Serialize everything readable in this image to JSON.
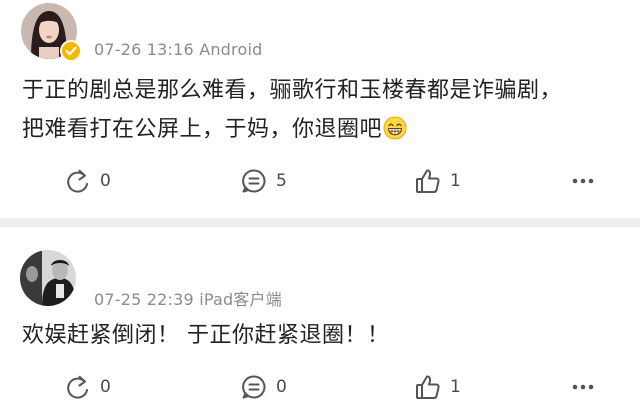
{
  "posts": [
    {
      "timestamp": "07-26 13:16",
      "source": "Android",
      "line1": "于正的剧总是那么难看，骊歌行和玉楼春都是诈骗剧，",
      "line2": "把难看打在公屏上，于妈，你退圈吧",
      "emoji": "grinning-face-icon",
      "reposts": "0",
      "comments": "5",
      "likes": "1",
      "verified": true,
      "badge_color": "#f5b800"
    },
    {
      "timestamp": "07-25 22:39",
      "source": "iPad客户端",
      "line1": "欢娱赶紧倒闭！ 于正你赶紧退圈！！",
      "reposts": "0",
      "comments": "0",
      "likes": "1"
    }
  ]
}
